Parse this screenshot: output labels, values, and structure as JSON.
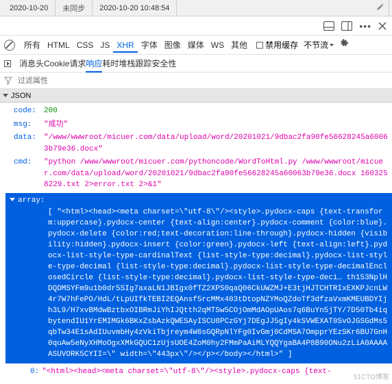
{
  "header": {
    "date": "2020-10-20",
    "sync_status": "未同步",
    "timestamp": "2020-10-20 10:48:54"
  },
  "toolbar1_icons": [
    "panel-icon",
    "split-icon",
    "more-icon",
    "close-icon"
  ],
  "filter_tabs": {
    "items": [
      "所有",
      "HTML",
      "CSS",
      "JS",
      "XHR",
      "字体",
      "图像",
      "媒体",
      "WS",
      "其他"
    ],
    "active_index": 4,
    "disable_cache": "禁用缓存",
    "throttle": "不节流"
  },
  "subtabs": {
    "items": [
      "消息头",
      "Cookie",
      "请求",
      "响应",
      "耗时",
      "堆栈跟踪",
      "安全性"
    ],
    "active_index": 3
  },
  "filter_placeholder": "过滤属性",
  "json_label": "JSON",
  "json": {
    "code_key": "code:",
    "code_val": "200",
    "msg_key": "msg:",
    "msg_val": "\"成功\"",
    "data_key": "data:",
    "data_val": "\"/www/wwwroot/micuer.com/data/upload/word/20201021/9dbac2fa90fe56628245a60063b79e36.docx\"",
    "cmd_key": "cmd:",
    "cmd_val": "\"python /www/wwwroot/micuer.com/pythoncode/WordToHtml.py /www/wwwroot/micuer.com/data/upload/word/20201021/9dbac2fa90fe56628245a60063b79e36.docx 1603258229.txt 2>error.txt 2>&1\"",
    "array_key": "array:",
    "array_val": "[ \"<html><head><meta charset=\\\"utf-8\\\"/><style>.pydocx-caps {text-transform:uppercase}.pydocx-center {text-align:center}.pydocx-comment {color:blue}.pydocx-delete {color:red;text-decoration:line-through}.pydocx-hidden {visibility:hidden}.pydocx-insert {color:green}.pydocx-left {text-align:left}.pydocx-list-style-type-cardinalText {list-style-type:decimal}.pydocx-list-style-type-decimal {list-style-type:decimal}.pydocx-list-style-type-decimalEnclosedCircle {list-style-type:decimal}.pydocx-list-style-type-deci… th153NplHDQDMSYFm9u1b0dr5SIg7axaLN1JBIgx0fTZ2XPS0qaQ06CkUWZMJ+E3tjHJTCHTRIxEXKPJcnLW4r7W7hFePO/HdL/tLpUIfkTEBI2EQAnsf5rcMMx403tDtopNZYMoQZdoTf3dfzaVxmKMEUBDYIjh3L9/H7xvBMdwBztbxOIBRmJiYhIJQtth2qMTSw5COjOmMdAOpUAos7q6BuYn5jTY/7D50Tb4iqbytendIU1YrEMIMGk6BKxZsbAzkQWESAyISCU8PCzGYj7DEgJJ5gIy4kSVWEXAT0SvOJGSGdMs5qbTw34E1sAdIUuvmbHy4zVkiTbjreym4W6sGQRpNlYFg0IvGmj0CdMSA7OmpprYEzSKr6BU7GnH0quAw5eNyXHMoOgxXMkGQUC1zUjsUOE4ZoM0hy2FMmPaAiMLYQQYgaBA4P8B90ONu2zLiA0AAAAASUVORK5CYII=\\\" width=\\\"443px\\\"/></p></body></html>\" ]",
    "item0_key": "0:",
    "item0_val": "\"<html><head><meta charset=\\\"utf-8\\\"/><style>.pydocx-caps {text-"
  },
  "watermark": "51CTO博客"
}
